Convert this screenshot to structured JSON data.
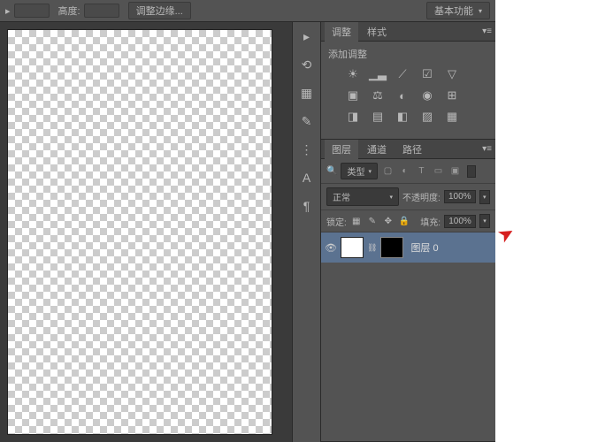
{
  "topbar": {
    "height_label": "高度:",
    "adjust_edges": "调整边缘...",
    "workspace": "基本功能"
  },
  "panels": {
    "adjustments": {
      "tab1": "调整",
      "tab2": "样式",
      "title": "添加调整"
    },
    "layers": {
      "tab1": "图层",
      "tab2": "通道",
      "tab3": "路径",
      "type_filter": "类型",
      "blend_mode": "正常",
      "opacity_label": "不透明度:",
      "opacity_value": "100%",
      "lock_label": "锁定:",
      "fill_label": "填充:",
      "fill_value": "100%",
      "layer0": {
        "name": "图层 0"
      }
    }
  }
}
